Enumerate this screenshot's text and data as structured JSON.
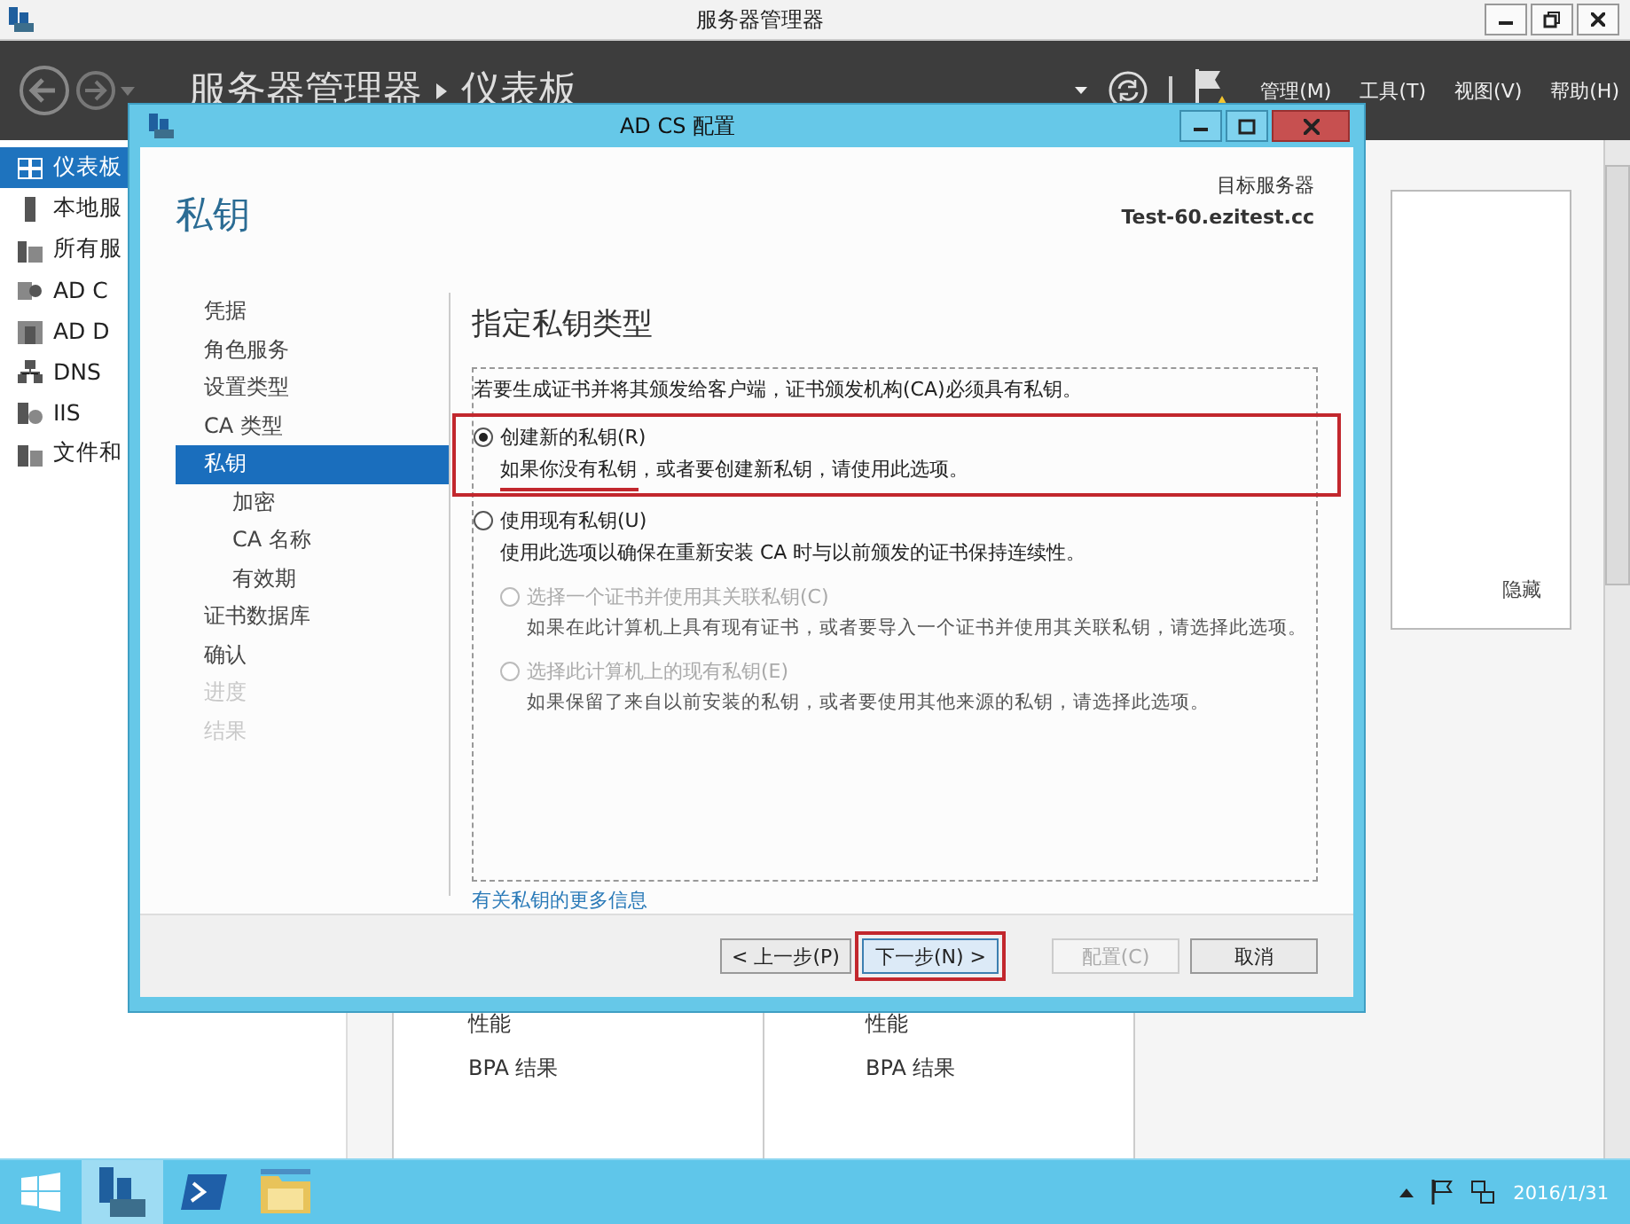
{
  "window": {
    "title": "服务器管理器"
  },
  "header": {
    "breadcrumb": [
      "服务器管理器",
      "仪表板"
    ],
    "menus": [
      "管理(M)",
      "工具(T)",
      "视图(V)",
      "帮助(H)"
    ]
  },
  "sidebar": {
    "items": [
      {
        "label": "仪表板",
        "kind": "dashboard",
        "selected": true
      },
      {
        "label": "本地服",
        "kind": "server",
        "selected": false
      },
      {
        "label": "所有服",
        "kind": "servers",
        "selected": false
      },
      {
        "label": "AD C",
        "kind": "adcs",
        "selected": false
      },
      {
        "label": "AD D",
        "kind": "adds",
        "selected": false
      },
      {
        "label": "DNS",
        "kind": "dns",
        "selected": false
      },
      {
        "label": "IIS",
        "kind": "iis",
        "selected": false
      },
      {
        "label": "文件和",
        "kind": "files",
        "selected": false
      }
    ]
  },
  "tiles": {
    "hide_label": "隐藏",
    "columns": [
      {
        "items": [
          "性能",
          "BPA 结果"
        ]
      },
      {
        "items": [
          "性能",
          "BPA 结果"
        ]
      }
    ]
  },
  "dialog": {
    "title": "AD CS 配置",
    "page_title": "私钥",
    "target_label": "目标服务器",
    "target_server": "Test-60.ezitest.cc",
    "nav": [
      {
        "label": "凭据",
        "selected": false,
        "disabled": false
      },
      {
        "label": "角色服务",
        "selected": false,
        "disabled": false
      },
      {
        "label": "设置类型",
        "selected": false,
        "disabled": false
      },
      {
        "label": "CA 类型",
        "selected": false,
        "disabled": false
      },
      {
        "label": "私钥",
        "selected": true,
        "disabled": false,
        "children": [
          {
            "label": "加密",
            "selected": false,
            "disabled": false
          },
          {
            "label": "CA 名称",
            "selected": false,
            "disabled": false
          },
          {
            "label": "有效期",
            "selected": false,
            "disabled": false
          }
        ]
      },
      {
        "label": "证书数据库",
        "selected": false,
        "disabled": false
      },
      {
        "label": "确认",
        "selected": false,
        "disabled": false
      },
      {
        "label": "进度",
        "selected": false,
        "disabled": true
      },
      {
        "label": "结果",
        "selected": false,
        "disabled": true
      }
    ],
    "heading": "指定私钥类型",
    "intro": "若要生成证书并将其颁发给客户端，证书颁发机构(CA)必须具有私钥。",
    "options": [
      {
        "label": "创建新的私钥(R)",
        "description": "如果你没有私钥，或者要创建新私钥，请使用此选项。",
        "selected": true,
        "disabled": false,
        "highlighted": true
      },
      {
        "label": "使用现有私钥(U)",
        "description": "使用此选项以确保在重新安装 CA 时与以前颁发的证书保持连续性。",
        "selected": false,
        "disabled": false,
        "children": [
          {
            "label": "选择一个证书并使用其关联私钥(C)",
            "description": "如果在此计算机上具有现有证书，或者要导入一个证书并使用其关联私钥，请选择此选项。",
            "selected": false,
            "disabled": true
          },
          {
            "label": "选择此计算机上的现有私钥(E)",
            "description": "如果保留了来自以前安装的私钥，或者要使用其他来源的私钥，请选择此选项。",
            "selected": false,
            "disabled": true
          }
        ]
      }
    ],
    "more_link": "有关私钥的更多信息",
    "buttons": [
      {
        "label": "< 上一步(P)",
        "disabled": false,
        "focused": false
      },
      {
        "label": "下一步(N) >",
        "disabled": false,
        "highlighted": true,
        "focused": true
      },
      {
        "label": "配置(C)",
        "disabled": true,
        "focused": false
      },
      {
        "label": "取消",
        "disabled": false,
        "focused": false
      }
    ]
  },
  "taskbar": {
    "apps": [
      {
        "kind": "server-manager",
        "selected": true
      },
      {
        "kind": "powershell",
        "selected": false
      },
      {
        "kind": "explorer",
        "selected": false
      }
    ],
    "date": "2016/1/31"
  }
}
